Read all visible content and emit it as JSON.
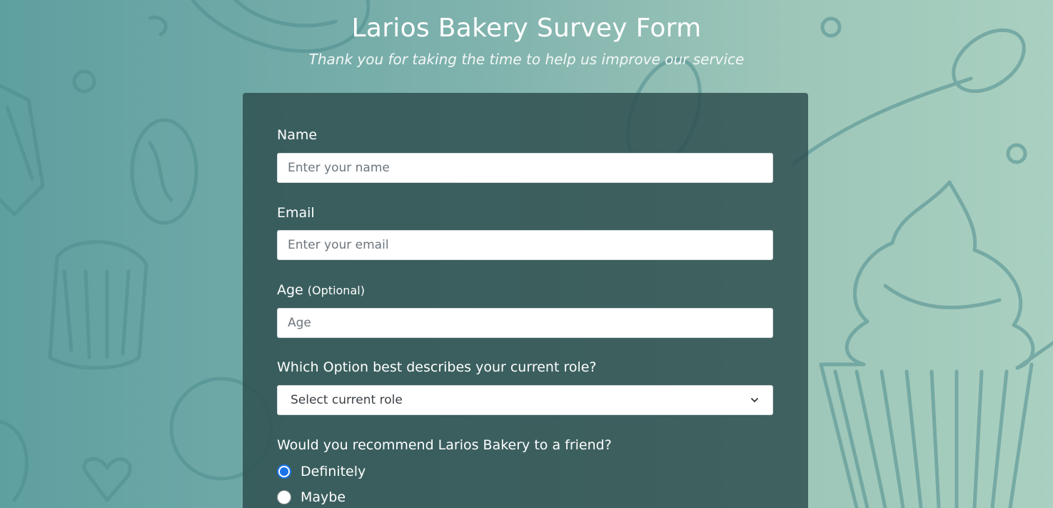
{
  "header": {
    "title": "Larios Bakery Survey Form",
    "subtitle": "Thank you for taking the time to help us improve our service"
  },
  "form": {
    "name": {
      "label": "Name",
      "placeholder": "Enter your name",
      "value": ""
    },
    "email": {
      "label": "Email",
      "placeholder": "Enter your email",
      "value": ""
    },
    "age": {
      "label": "Age",
      "optional_note": "(Optional)",
      "placeholder": "Age",
      "value": ""
    },
    "role": {
      "label": "Which Option best describes your current role?",
      "selected": "Select current role"
    },
    "recommend": {
      "label": "Would you recommend Larios Bakery to a friend?",
      "options": [
        {
          "label": "Definitely",
          "checked": true
        },
        {
          "label": "Maybe",
          "checked": false
        }
      ]
    }
  },
  "colors": {
    "card_background": "#2f5050",
    "radio_accent": "#1a73e8"
  },
  "icons": {
    "select_arrow": "chevron-down-icon"
  }
}
